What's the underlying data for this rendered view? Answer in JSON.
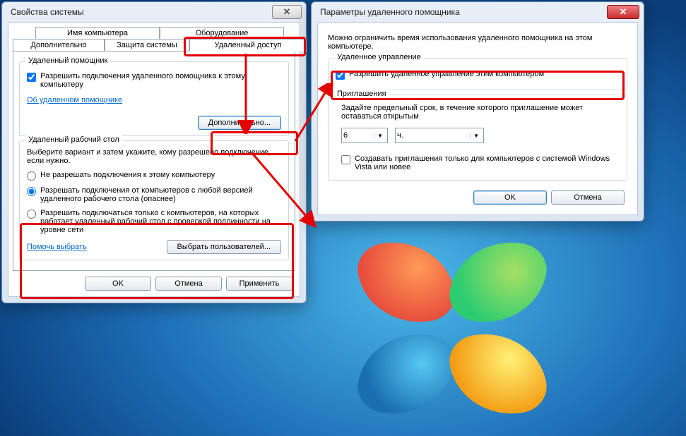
{
  "win1": {
    "title": "Свойства системы",
    "tabs": {
      "computer_name": "Имя компьютера",
      "hardware": "Оборудование",
      "advanced": "Дополнительно",
      "protection": "Защита системы",
      "remote": "Удаленный доступ"
    },
    "assistant_group": "Удаленный помощник",
    "allow_assistant": "Разрешить подключения удаленного помощника к этому компьютеру",
    "about_link": "Об удаленном помощнике",
    "advanced_btn": "Дополнительно...",
    "rdp_group": "Удаленный рабочий стол",
    "rdp_intro": "Выберите вариант и затем укажите, кому разрешено подключение, если нужно.",
    "opt_none": "Не разрешать подключения к этому компьютеру",
    "opt_any": "Разрешать подключения от компьютеров с любой версией удаленного рабочего стола (опаснее)",
    "opt_nla": "Разрешить подключаться только с компьютеров, на которых работает удаленный рабочий стол с проверкой подлинности на уровне сети",
    "help_link": "Помочь выбрать",
    "select_users": "Выбрать пользователей...",
    "ok": "OK",
    "cancel": "Отмена",
    "apply": "Применить"
  },
  "win2": {
    "title": "Параметры удаленного помощника",
    "intro": "Можно ограничить время использования удаленного помощника на этом компьютере.",
    "control_group": "Удаленное управление",
    "allow_control": "Разрешить удаленное управление этим компьютером",
    "invite_group": "Приглашения",
    "invite_text": "Задайте предельный срок, в течение которого приглашение может оставаться открытым",
    "num_value": "6",
    "unit_value": "ч.",
    "vista_only": "Создавать приглашения только для компьютеров с системой Windows Vista или новее",
    "ok": "OK",
    "cancel": "Отмена"
  }
}
